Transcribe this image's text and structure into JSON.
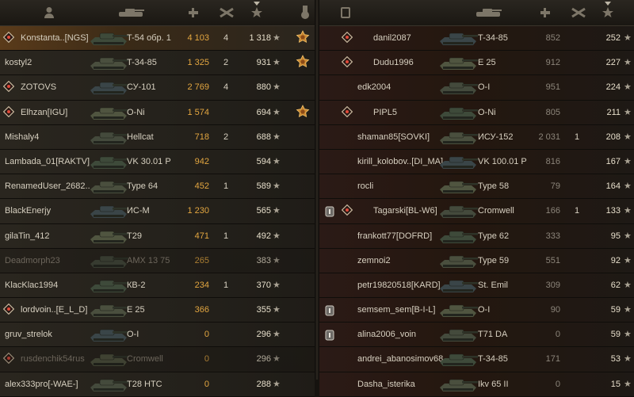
{
  "left_team": {
    "players": [
      {
        "name": "Konstanta..[NGS]",
        "tank": "T-54 обр. 1",
        "damage": "4 103",
        "frags": "4",
        "xp": "1 318",
        "badge": true,
        "medal": true,
        "self": true
      },
      {
        "name": "kostyl2",
        "tank": "T-34-85",
        "damage": "1 325",
        "frags": "2",
        "xp": "931",
        "badge": false,
        "medal": true
      },
      {
        "name": "ZOTOVS",
        "tank": "СУ-101",
        "damage": "2 769",
        "frags": "4",
        "xp": "880",
        "badge": true,
        "medal": false
      },
      {
        "name": "Elhzan[IGU]",
        "tank": "O-Ni",
        "damage": "1 574",
        "frags": "",
        "xp": "694",
        "badge": true,
        "medal": true
      },
      {
        "name": "Mishaly4",
        "tank": "Hellcat",
        "damage": "718",
        "frags": "2",
        "xp": "688",
        "badge": false,
        "medal": false
      },
      {
        "name": "Lambada_01[RAKTV]",
        "tank": "VK 30.01 P",
        "damage": "942",
        "frags": "",
        "xp": "594",
        "badge": false,
        "medal": false
      },
      {
        "name": "RenamedUser_2682..",
        "tank": "Type 64",
        "damage": "452",
        "frags": "1",
        "xp": "589",
        "badge": false,
        "medal": false
      },
      {
        "name": "BlackEnerjy",
        "tank": "ИС-М",
        "damage": "1 230",
        "frags": "",
        "xp": "565",
        "badge": false,
        "medal": false
      },
      {
        "name": "gilaTin_412",
        "tank": "T29",
        "damage": "471",
        "frags": "1",
        "xp": "492",
        "badge": false,
        "medal": false
      },
      {
        "name": "Deadmorph23",
        "tank": "AMX 13 75",
        "damage": "265",
        "frags": "",
        "xp": "383",
        "badge": false,
        "medal": false,
        "dead": true
      },
      {
        "name": "KlacKlac1994",
        "tank": "КВ-2",
        "damage": "234",
        "frags": "1",
        "xp": "370",
        "badge": false,
        "medal": false
      },
      {
        "name": "lordvoin..[E_L_D]",
        "tank": "E 25",
        "damage": "366",
        "frags": "",
        "xp": "355",
        "badge": true,
        "medal": false
      },
      {
        "name": "gruv_strelok",
        "tank": "O-I",
        "damage": "0",
        "frags": "",
        "xp": "296",
        "badge": false,
        "medal": false
      },
      {
        "name": "rusdenchik54rus",
        "tank": "Cromwell",
        "damage": "0",
        "frags": "",
        "xp": "296",
        "badge": true,
        "medal": false,
        "dead": true
      },
      {
        "name": "alex333pro[-WAE-]",
        "tank": "T28 HTC",
        "damage": "0",
        "frags": "",
        "xp": "288",
        "badge": false,
        "medal": false
      }
    ]
  },
  "right_team": {
    "players": [
      {
        "name": "danil2087",
        "tank": "T-34-85",
        "damage": "852",
        "frags": "",
        "xp": "252",
        "badge": "diamond"
      },
      {
        "name": "Dudu1996",
        "tank": "E 25",
        "damage": "912",
        "frags": "",
        "xp": "227",
        "badge": "diamond"
      },
      {
        "name": "edk2004",
        "tank": "O-I",
        "damage": "951",
        "frags": "",
        "xp": "224",
        "badge": "none"
      },
      {
        "name": "PIPL5",
        "tank": "O-Ni",
        "damage": "805",
        "frags": "",
        "xp": "211",
        "badge": "diamond"
      },
      {
        "name": "shaman85[SOVKI]",
        "tank": "ИСУ-152",
        "damage": "2 031",
        "frags": "1",
        "xp": "208",
        "badge": "none"
      },
      {
        "name": "kirill_kolobov..[DI_MA]",
        "tank": "VK 100.01 P",
        "damage": "816",
        "frags": "",
        "xp": "167",
        "badge": "none"
      },
      {
        "name": "rocli",
        "tank": "Type 58",
        "damage": "79",
        "frags": "",
        "xp": "164",
        "badge": "none"
      },
      {
        "name": "Tagarski[BL-W6]",
        "tank": "Cromwell",
        "damage": "166",
        "frags": "1",
        "xp": "133",
        "badge": "shield-diamond"
      },
      {
        "name": "frankott77[DOFRD]",
        "tank": "Type 62",
        "damage": "333",
        "frags": "",
        "xp": "95",
        "badge": "none"
      },
      {
        "name": "zemnoi2",
        "tank": "Type 59",
        "damage": "551",
        "frags": "",
        "xp": "92",
        "badge": "none"
      },
      {
        "name": "petr19820518[KARD]",
        "tank": "St. Emil",
        "damage": "309",
        "frags": "",
        "xp": "62",
        "badge": "none"
      },
      {
        "name": "semsem_sem[B-I-L]",
        "tank": "O-I",
        "damage": "90",
        "frags": "",
        "xp": "59",
        "badge": "shield"
      },
      {
        "name": "alina2006_voin",
        "tank": "T71 DA",
        "damage": "0",
        "frags": "",
        "xp": "59",
        "badge": "shield"
      },
      {
        "name": "andrei_abanosimov68",
        "tank": "T-34-85",
        "damage": "171",
        "frags": "",
        "xp": "53",
        "badge": "none"
      },
      {
        "name": "Dasha_isterika",
        "tank": "Ikv 65 II",
        "damage": "0",
        "frags": "",
        "xp": "15",
        "badge": "none"
      }
    ]
  },
  "colors": {
    "damage_highlight": "#e3a640",
    "self_row": "#5a3b1a",
    "enemy_row": "#2b1a16",
    "ally_row": "#2a261f"
  }
}
